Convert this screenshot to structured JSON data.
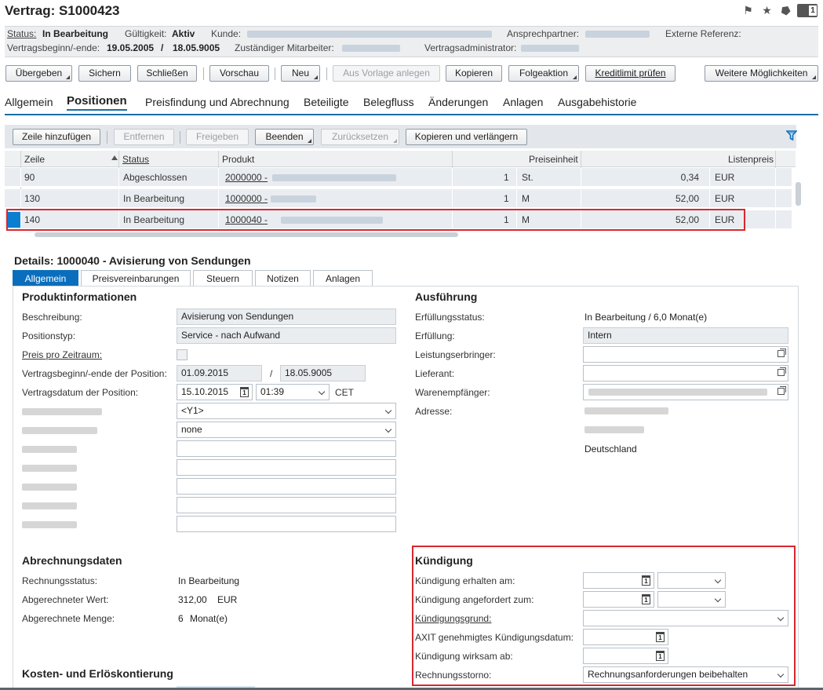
{
  "title": "Vertrag: S1000423",
  "header": {
    "status_label": "Status:",
    "status_value": "In Bearbeitung",
    "validity_label": "Gültigkeit:",
    "validity_value": "Aktiv",
    "customer_label": "Kunde:",
    "contact_label": "Ansprechpartner:",
    "extref_label": "Externe Referenz:",
    "start_end_label": "Vertragsbeginn/-ende:",
    "start_value": "19.05.2005",
    "slash": "/",
    "end_value": "18.05.9005",
    "employee_label": "Zuständiger Mitarbeiter:",
    "admin_label": "Vertragsadministrator:"
  },
  "toolbar": {
    "uebergeben": "Übergeben",
    "sichern": "Sichern",
    "schliessen": "Schließen",
    "vorschau": "Vorschau",
    "neu": "Neu",
    "aus_vorlage": "Aus Vorlage anlegen",
    "kopieren": "Kopieren",
    "folgeaktion": "Folgeaktion",
    "kreditlimit": "Kreditlimit prüfen",
    "weitere": "Weitere Möglichkeiten"
  },
  "tabs": [
    "Allgemein",
    "Positionen",
    "Preisfindung und Abrechnung",
    "Beteiligte",
    "Belegfluss",
    "Änderungen",
    "Anlagen",
    "Ausgabehistorie"
  ],
  "items_toolbar": {
    "add": "Zeile hinzufügen",
    "remove": "Entfernen",
    "release": "Freigeben",
    "finish": "Beenden",
    "reset": "Zurücksetzen",
    "copy_extend": "Kopieren und verlängern"
  },
  "grid": {
    "headers": [
      "Zeile",
      "Status",
      "Produkt",
      "Preiseinheit",
      "Listenpreis"
    ],
    "rows": [
      {
        "line": "90",
        "status": "Abgeschlossen",
        "product": "2000000 - ",
        "qty": "1",
        "unit": "St.",
        "price": "0,34",
        "cur": "EUR"
      },
      {
        "line": "130",
        "status": "In Bearbeitung",
        "product": "1000000 - ",
        "qty": "1",
        "unit": "M",
        "price": "52,00",
        "cur": "EUR"
      },
      {
        "line": "140",
        "status": "In Bearbeitung",
        "product": "1000040 - ",
        "qty": "1",
        "unit": "M",
        "price": "52,00",
        "cur": "EUR"
      }
    ]
  },
  "details": {
    "title": "Details:  1000040 - Avisierung von Sendungen",
    "tabs": [
      "Allgemein",
      "Preisvereinbarungen",
      "Steuern",
      "Notizen",
      "Anlagen"
    ],
    "prod": {
      "title": "Produktinformationen",
      "desc_label": "Beschreibung:",
      "desc_value": "Avisierung von Sendungen",
      "type_label": "Positionstyp:",
      "type_value": "Service - nach Aufwand",
      "ppz_label": "Preis pro Zeitraum:",
      "period_label": "Vertragsbeginn/-ende der Position:",
      "period_start": "01.09.2015",
      "period_sep": "/",
      "period_end": "18.05.9005",
      "date_label": "Vertragsdatum der Position:",
      "date_value": "15.10.2015",
      "time_value": "01:39",
      "tz": "CET",
      "select1": "<Y1>",
      "select2": "none"
    },
    "exec": {
      "title": "Ausführung",
      "fstatus_label": "Erfüllungsstatus:",
      "fstatus_value": "In Bearbeitung / 6,0 Monat(e)",
      "fulfill_label": "Erfüllung:",
      "fulfill_value": "Intern",
      "provider_label": "Leistungserbringer:",
      "supplier_label": "Lieferant:",
      "consignee_label": "Warenempfänger:",
      "address_label": "Adresse:",
      "country": "Deutschland"
    },
    "billing": {
      "title": "Abrechnungsdaten",
      "status_label": "Rechnungsstatus:",
      "status_value": "In Bearbeitung",
      "value_label": "Abgerechneter Wert:",
      "value": "312,00",
      "cur": "EUR",
      "qty_label": "Abgerechnete Menge:",
      "qty": "6",
      "unit": "Monat(e)"
    },
    "cost": {
      "title": "Kosten- und Erlöskontierung"
    },
    "kuend": {
      "title": "Kündigung",
      "received_label": "Kündigung erhalten am:",
      "requested_label": "Kündigung angefordert zum:",
      "reason_label": "Kündigungsgrund:",
      "axit_label": "AXIT genehmigtes Kündigungsdatum:",
      "effective_label": "Kündigung wirksam ab:",
      "storno_label": "Rechnungsstorno:",
      "storno_value": "Rechnungsanforderungen beibehalten"
    }
  },
  "icons": {
    "flag": "flag-icon",
    "star": "star-icon",
    "tag": "tag-icon",
    "count": "1"
  }
}
